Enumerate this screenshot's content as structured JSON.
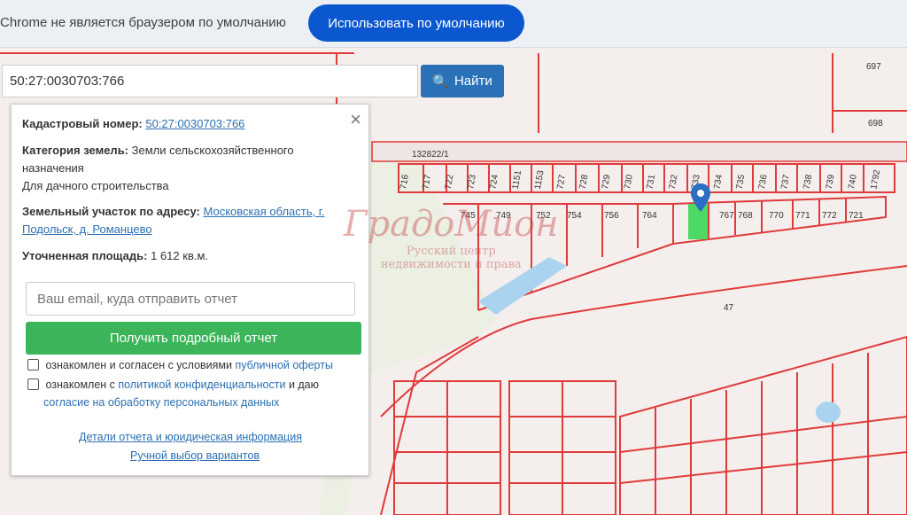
{
  "browser_bar": {
    "message": "Chrome не является браузером по умолчанию",
    "default_button": "Использовать по умолчанию"
  },
  "search": {
    "value": "50:27:0030703:766",
    "button_label": "Найти",
    "button_icon": "search-icon"
  },
  "panel": {
    "cadastral_label": "Кадастровый номер:",
    "cadastral_value": "50:27:0030703:766",
    "category_label": "Категория земель:",
    "category_value_line1": "Земли сельскохозяйственного",
    "category_value_line2": "назначения",
    "category_value_line3": "Для дачного строительства",
    "address_label": "Земельный участок по адресу:",
    "address_value_line1": "Московская область, г.",
    "address_value_line2": "Подольск, д. Романцево",
    "area_label": "Уточненная площадь:",
    "area_value": "1 612 кв.м.",
    "email_placeholder": "Ваш email, куда отправить отчет",
    "report_button": "Получить подробный отчет",
    "check1_text": "ознакомлен и согласен с условиями",
    "check1_link": "публичной оферты",
    "check2_text": "ознакомлен с",
    "check2_link": "политикой конфиденциальности",
    "check2_and": "и даю",
    "check2_link2": "согласие на обработку персональных данных",
    "details_link": "Детали отчета и юридическая информация",
    "manual_link": "Ручной выбор вариантов"
  },
  "watermark": {
    "title": "ГрадоМион",
    "line1": "Русский центр",
    "line2": "недвижимости и права"
  },
  "map": {
    "road_label": "132822/1",
    "area_number": "47",
    "row_top": [
      "716",
      "717",
      "722",
      "723",
      "724",
      "1151",
      "1153",
      "727",
      "728",
      "729",
      "730",
      "731",
      "732",
      "733",
      "734",
      "735",
      "736",
      "737",
      "738",
      "739",
      "740",
      "1792"
    ],
    "row_mid": [
      "745",
      "749",
      "752",
      "754",
      "756",
      "764",
      "767",
      "768",
      "770",
      "771",
      "772",
      "721"
    ],
    "right_labels": [
      "697",
      "698"
    ],
    "accent": "#e03a3a",
    "selected": "#4cd964"
  }
}
